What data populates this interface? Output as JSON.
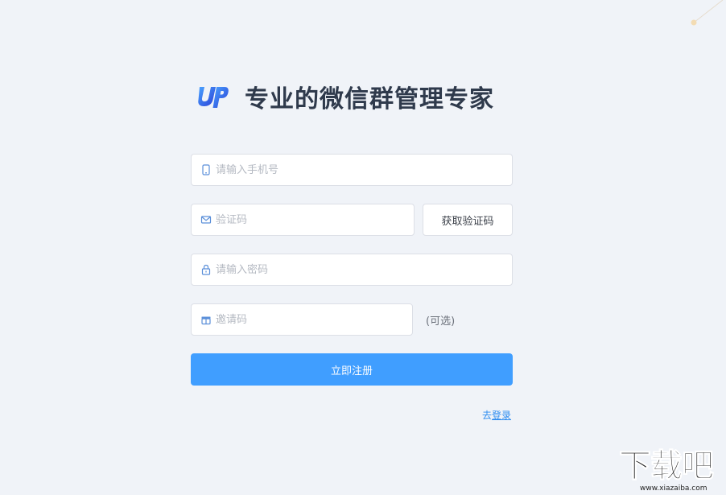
{
  "header": {
    "logo_icon": "up-logo-icon",
    "title": "专业的微信群管理专家"
  },
  "form": {
    "phone": {
      "icon": "phone-icon",
      "placeholder": "请输入手机号",
      "value": ""
    },
    "code": {
      "icon": "mail-icon",
      "placeholder": "验证码",
      "value": "",
      "button_label": "获取验证码"
    },
    "password": {
      "icon": "lock-icon",
      "placeholder": "请输入密码",
      "value": ""
    },
    "invite": {
      "icon": "gift-icon",
      "placeholder": "邀请码",
      "value": "",
      "hint": "(可选)"
    },
    "submit_label": "立即注册",
    "login_prefix": "去",
    "login_link": "登录"
  },
  "watermark": {
    "main": "下载吧",
    "sub": "www.xiazaiba.com"
  },
  "colors": {
    "accent": "#409eff",
    "link": "#2d8cf0",
    "background": "#f0f3f8",
    "title": "#2f3a4c"
  }
}
